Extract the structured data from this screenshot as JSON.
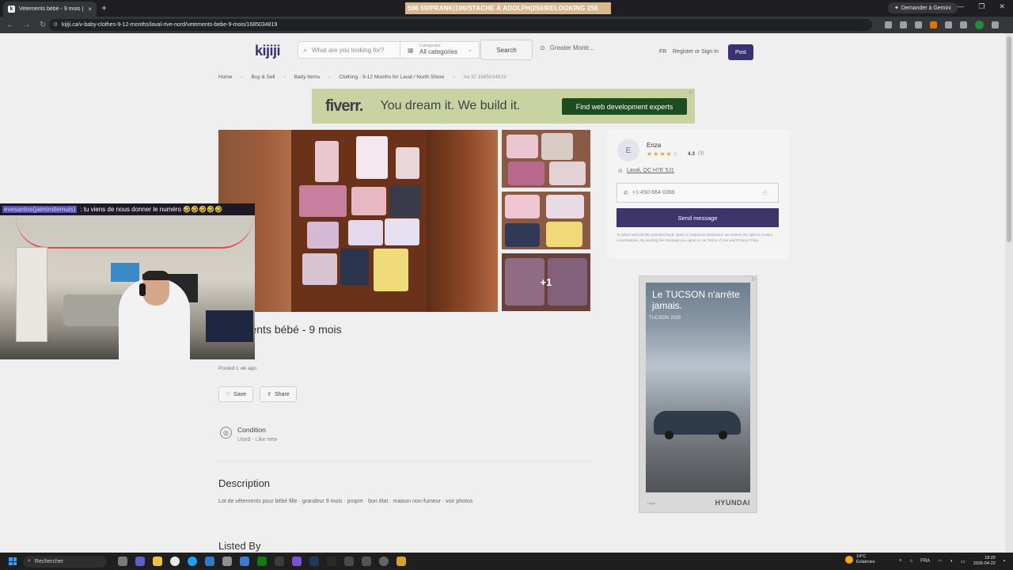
{
  "browser": {
    "tab_title": "Vetements bébé - 9 mois | Clot",
    "tab_favicon": "k",
    "close_glyph": "×",
    "new_tab_glyph": "+",
    "ticker_text": "586          50/PRANK|100/STACHE À ADOLPH|250/RELOOKING 250",
    "gemini_label": "Demander à Gemini",
    "url": "kijiji.ca/v-baby-clothes-9-12-months/laval-rive-nord/vetements-bebe-9-mois/1685034819"
  },
  "header": {
    "logo": "kijiji",
    "search_placeholder": "What are you looking for?",
    "category_small": "Categories",
    "category_value": "All categories",
    "search_button": "Search",
    "location": "Greater Montr...",
    "lang": "FR",
    "signin": "Register or Sign In",
    "post": "Post"
  },
  "breadcrumb": {
    "items": [
      "Home",
      "Buy & Sell",
      "Baby Items",
      "Clothing - 9-12 Months for Laval / North Shore"
    ],
    "ad_id": "Ad ID 1685034819"
  },
  "fiverr_ad": {
    "logo": "fiverr.",
    "tagline": "You dream it. We build it.",
    "cta": "Find web development experts"
  },
  "gallery": {
    "more_label": "+1"
  },
  "listing": {
    "title": "Vêtements bébé - 9 mois",
    "posted": "Posted 1 wk ago",
    "save": "Save",
    "share": "Share",
    "condition_label": "Condition",
    "condition_value": "Used - Like new",
    "description_heading": "Description",
    "description_text": "Lot de vêtements pour bébé fille · grandeur 9 mois · propre · bon état · maison non-fumeur · voir photos",
    "listed_by_heading": "Listed By"
  },
  "seller": {
    "initial": "E",
    "name": "Enza",
    "stars": "★★★★☆",
    "rating": "4.3",
    "rating_count": "(3)",
    "location": "Laval, QC H7E 5J1",
    "phone": "+1-450-664-0366",
    "send": "Send message",
    "disclaimer": "To detect and identify potential fraud, spam or suspicious behaviour, we reserve the right to monitor conversations. By sending the message you agree to our Terms of Use and Privacy Policy."
  },
  "hyundai_ad": {
    "headline": "Le TUCSON n'arrête jamais.",
    "sub": "TUCSON 2025",
    "logo": "HYUNDAI",
    "small": "Légal"
  },
  "stream_chat": {
    "user": "evesantos(jaimimitemuis)",
    "message": ": tu viens de nous donner le numéro 🤣🤣🤣🤣🤣"
  },
  "taskbar": {
    "search": "Rechercher",
    "weather_temp": "14°C",
    "weather_desc": "Éclaircies",
    "lang": "FRA",
    "time": "18:20",
    "date": "2026-04-22"
  }
}
